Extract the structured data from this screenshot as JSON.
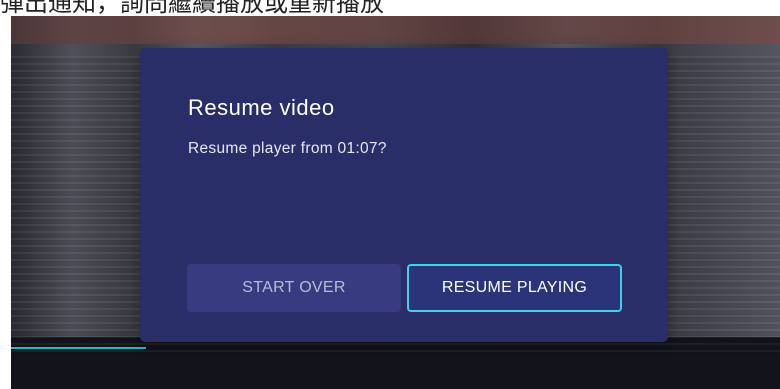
{
  "caption": "彈出通知，詢問繼續播放或重新播放",
  "dialog": {
    "title": "Resume video",
    "message": "Resume player from 01:07?",
    "buttons": {
      "start_over": "START OVER",
      "resume_playing": "RESUME PLAYING"
    }
  },
  "colors": {
    "dialog_bg": "#2a2e68",
    "focus_border": "#3fd2e6",
    "progress": "#2fb3c6"
  }
}
